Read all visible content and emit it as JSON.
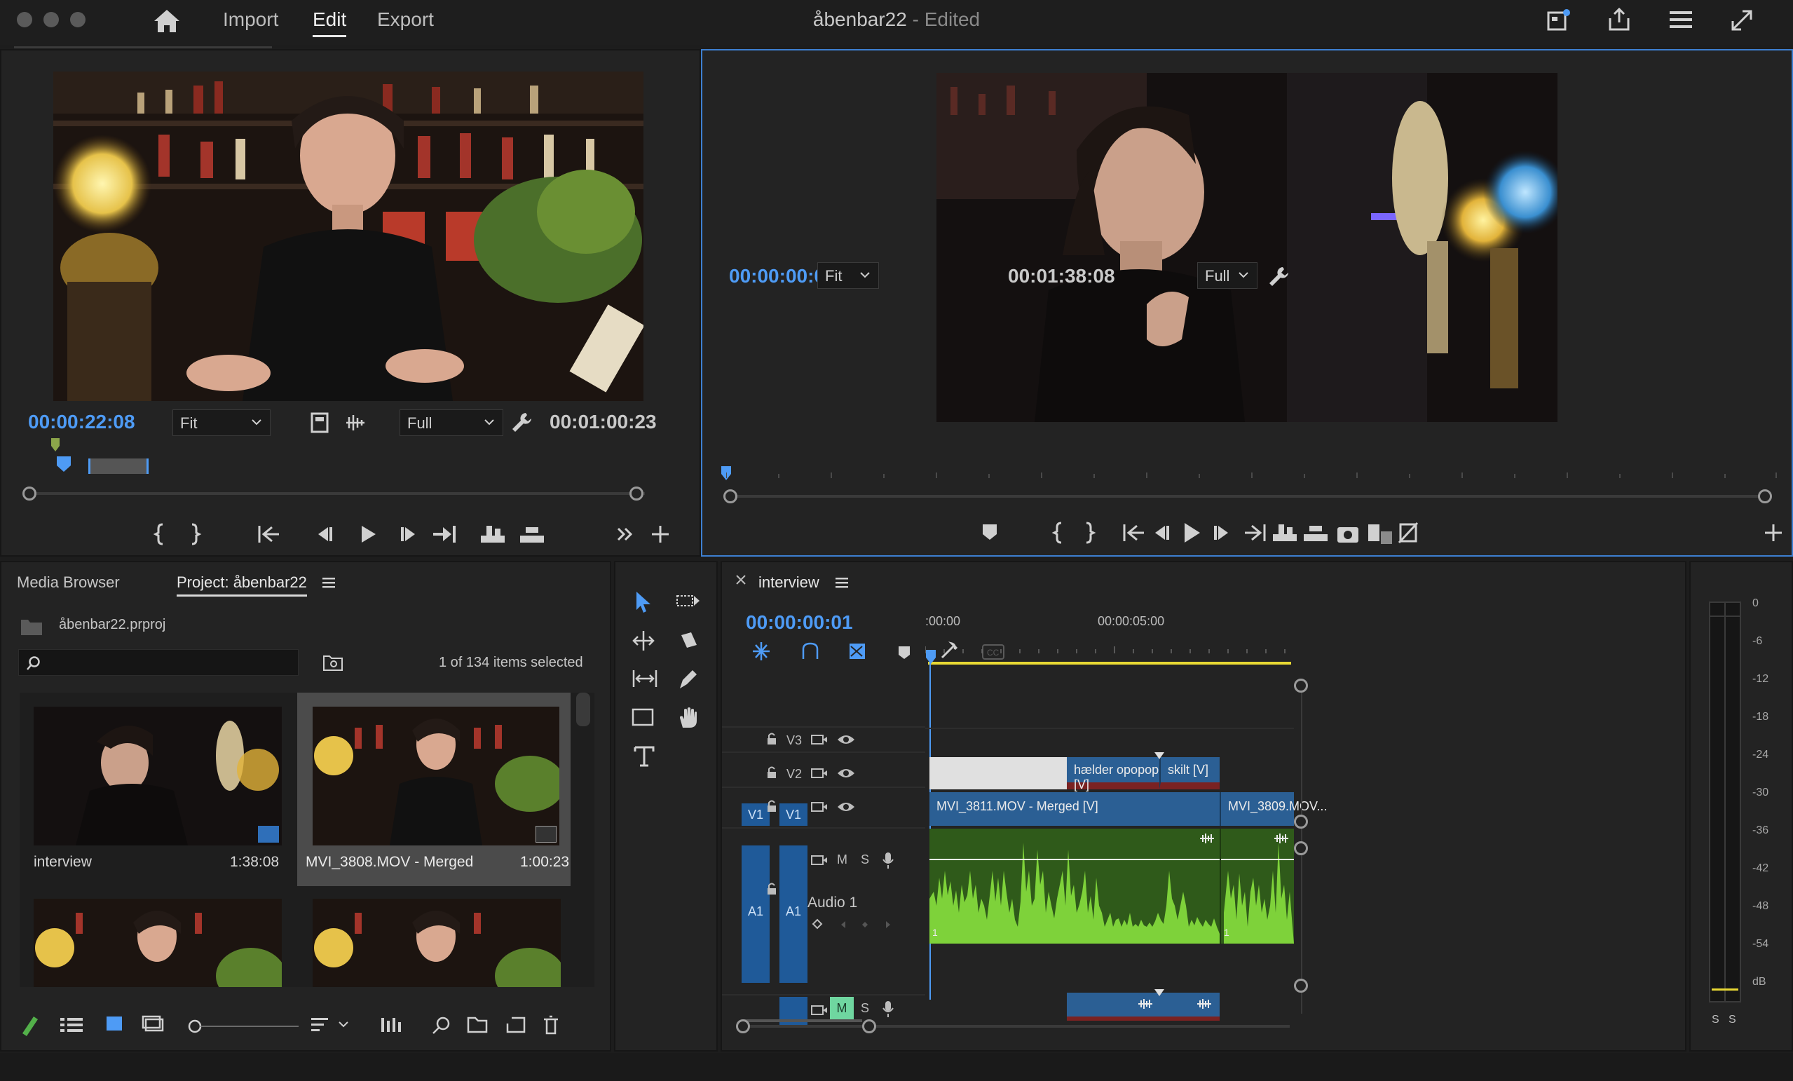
{
  "nav": {
    "import": "Import",
    "edit": "Edit",
    "export": "Export"
  },
  "title": {
    "name": "åbenbar22",
    "status": "- Edited"
  },
  "source": {
    "current_time": "00:00:22:08",
    "zoom": "Fit",
    "quality": "Full",
    "duration": "00:01:00:23"
  },
  "program": {
    "current_time": "00:00:00:01",
    "zoom": "Fit",
    "quality": "Full",
    "duration": "00:01:38:08"
  },
  "project": {
    "tab_media_browser": "Media Browser",
    "tab_project": "Project: åbenbar22",
    "file_name": "åbenbar22.prproj",
    "search_placeholder": "",
    "selection_status": "1 of 134 items selected",
    "items": [
      {
        "name": "interview",
        "duration": "1:38:08"
      },
      {
        "name": "MVI_3808.MOV - Merged",
        "duration": "1:00:23"
      }
    ]
  },
  "timeline": {
    "sequence_name": "interview",
    "current_time": "00:00:00:01",
    "ruler_start": ":00:00",
    "ruler_mark": "00:00:05:00",
    "tracks": {
      "v3": "V3",
      "v2": "V2",
      "v1_src": "V1",
      "v1": "V1",
      "a1_src": "A1",
      "a1": "A1",
      "audio_name": "Audio 1",
      "mute": "M",
      "solo": "S"
    },
    "clips": {
      "v2_a": "hælder opopop [V]",
      "v2_b": "skilt [V]",
      "v1_a": "MVI_3811.MOV - Merged [V]",
      "v1_b": "MVI_3809.MOV...",
      "a1_marker_a": "1",
      "a1_marker_b": "1"
    }
  },
  "meter": {
    "labels": [
      "0",
      "-6",
      "-12",
      "-18",
      "-24",
      "-30",
      "-36",
      "-42",
      "-48",
      "-54",
      "dB"
    ],
    "solo_left": "S",
    "solo_right": "S"
  },
  "colors": {
    "accent_blue": "#4e9bf5",
    "clip_blue": "#2b5f94",
    "audio_green": "#7ed23a",
    "audio_bg": "#2f5a1a",
    "clip_red": "#7a2222",
    "work_area_yellow": "#e8d834"
  }
}
